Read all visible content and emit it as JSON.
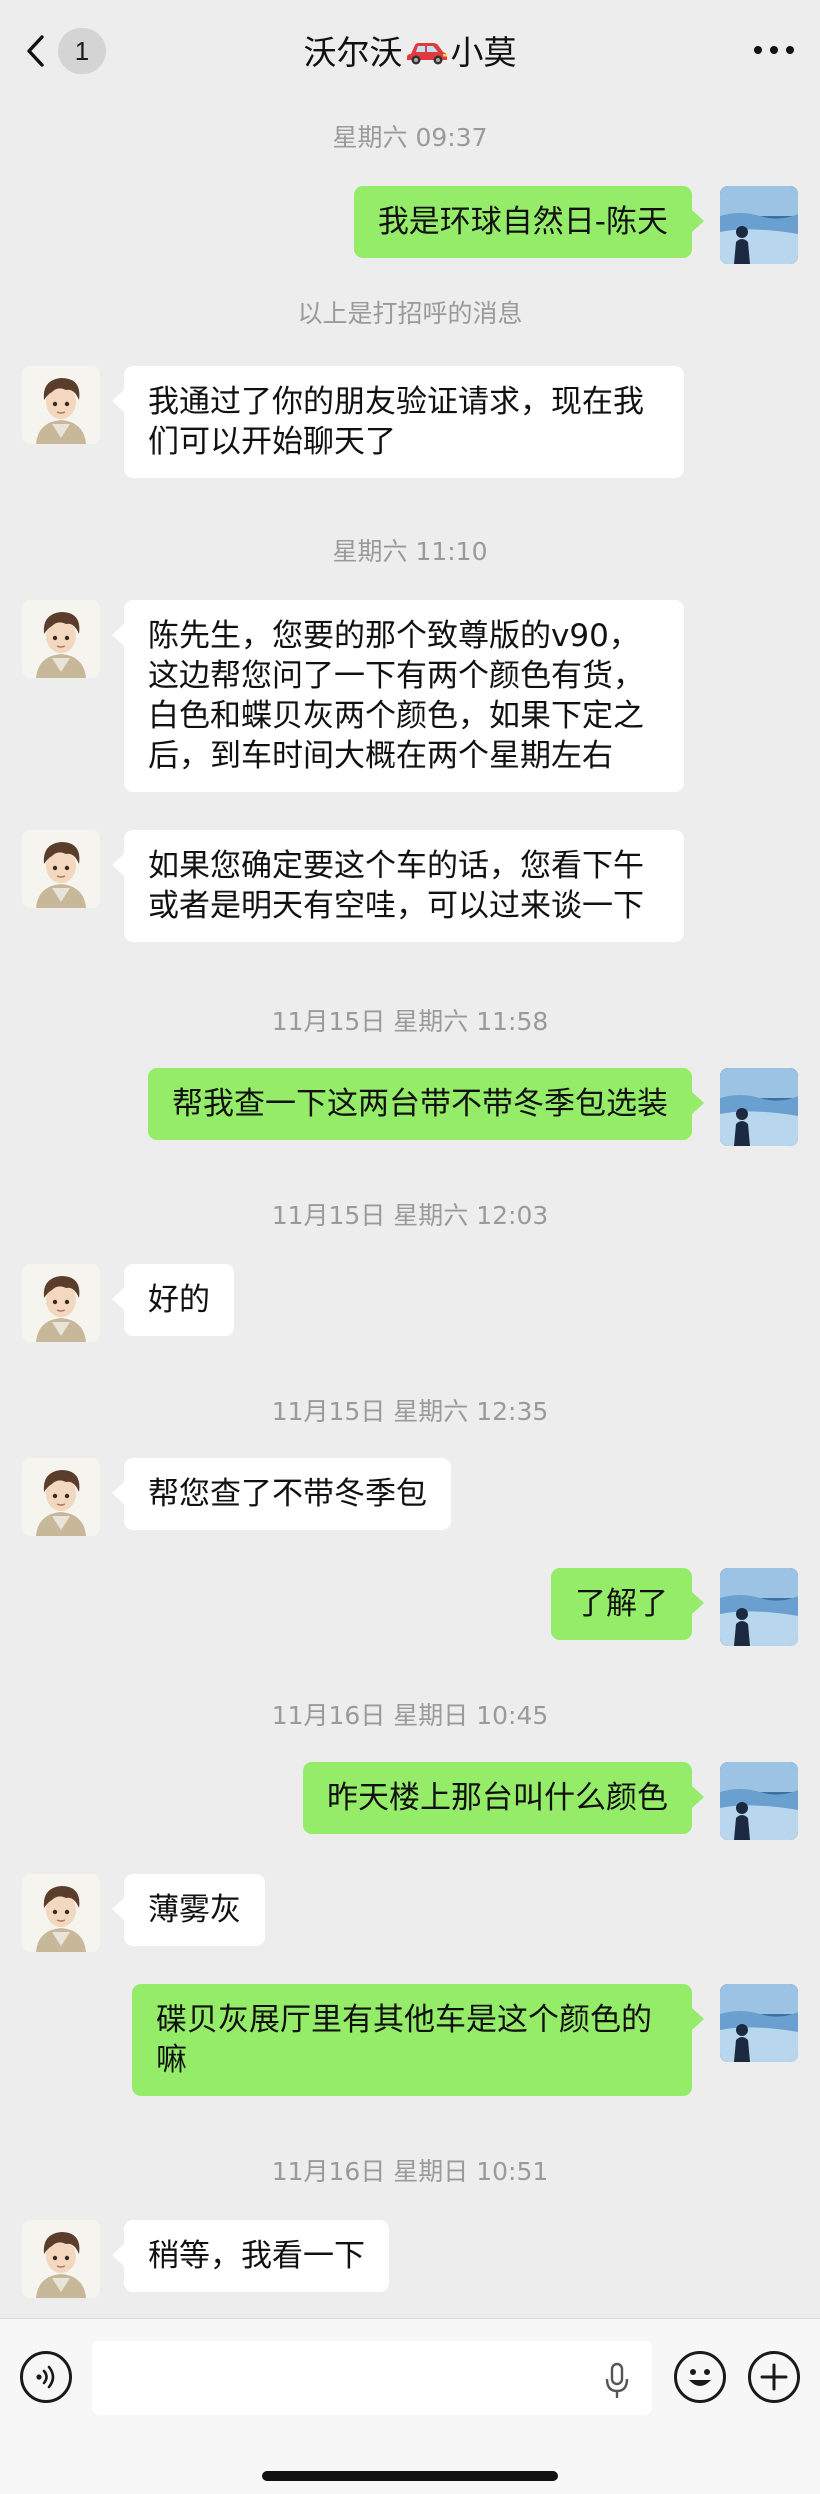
{
  "header": {
    "back_count": "1",
    "title_left": "沃尔沃",
    "title_right": "小莫",
    "title_emoji": "car-icon"
  },
  "messages": [
    {
      "type": "time",
      "text": "星期六 09:37"
    },
    {
      "type": "out",
      "text": "我是环球自然日-陈天"
    },
    {
      "type": "time",
      "text": "以上是打招呼的消息"
    },
    {
      "type": "in",
      "text": "我通过了你的朋友验证请求，现在我们可以开始聊天了"
    },
    {
      "type": "time",
      "text": "星期六 11:10"
    },
    {
      "type": "in",
      "text": "陈先生，您要的那个致尊版的v90，这边帮您问了一下有两个颜色有货，白色和蝶贝灰两个颜色，如果下定之后，到车时间大概在两个星期左右"
    },
    {
      "type": "in",
      "text": "如果您确定要这个车的话，您看下午或者是明天有空哇，可以过来谈一下"
    },
    {
      "type": "time",
      "text": "11月15日 星期六 11:58"
    },
    {
      "type": "out",
      "text": "帮我查一下这两台带不带冬季包选装"
    },
    {
      "type": "time",
      "text": "11月15日 星期六 12:03"
    },
    {
      "type": "in",
      "text": "好的"
    },
    {
      "type": "time",
      "text": "11月15日 星期六 12:35"
    },
    {
      "type": "in",
      "text": "帮您查了不带冬季包"
    },
    {
      "type": "out",
      "text": "了解了"
    },
    {
      "type": "time",
      "text": "11月16日 星期日 10:45"
    },
    {
      "type": "out",
      "text": "昨天楼上那台叫什么颜色"
    },
    {
      "type": "in",
      "text": "薄雾灰"
    },
    {
      "type": "out",
      "text": "碟贝灰展厅里有其他车是这个颜色的嘛"
    },
    {
      "type": "time",
      "text": "11月16日 星期日 10:51"
    },
    {
      "type": "in",
      "text": "稍等，我看一下"
    }
  ],
  "input": {
    "value": "",
    "voice_icon": "voice-icon",
    "mic_icon": "mic-icon",
    "emoji_icon": "emoji-icon",
    "plus_icon": "plus-icon"
  },
  "colors": {
    "background": "#ededed",
    "outgoing_bubble": "#95ec69",
    "incoming_bubble": "#ffffff",
    "timestamp": "#9a9a9a"
  }
}
